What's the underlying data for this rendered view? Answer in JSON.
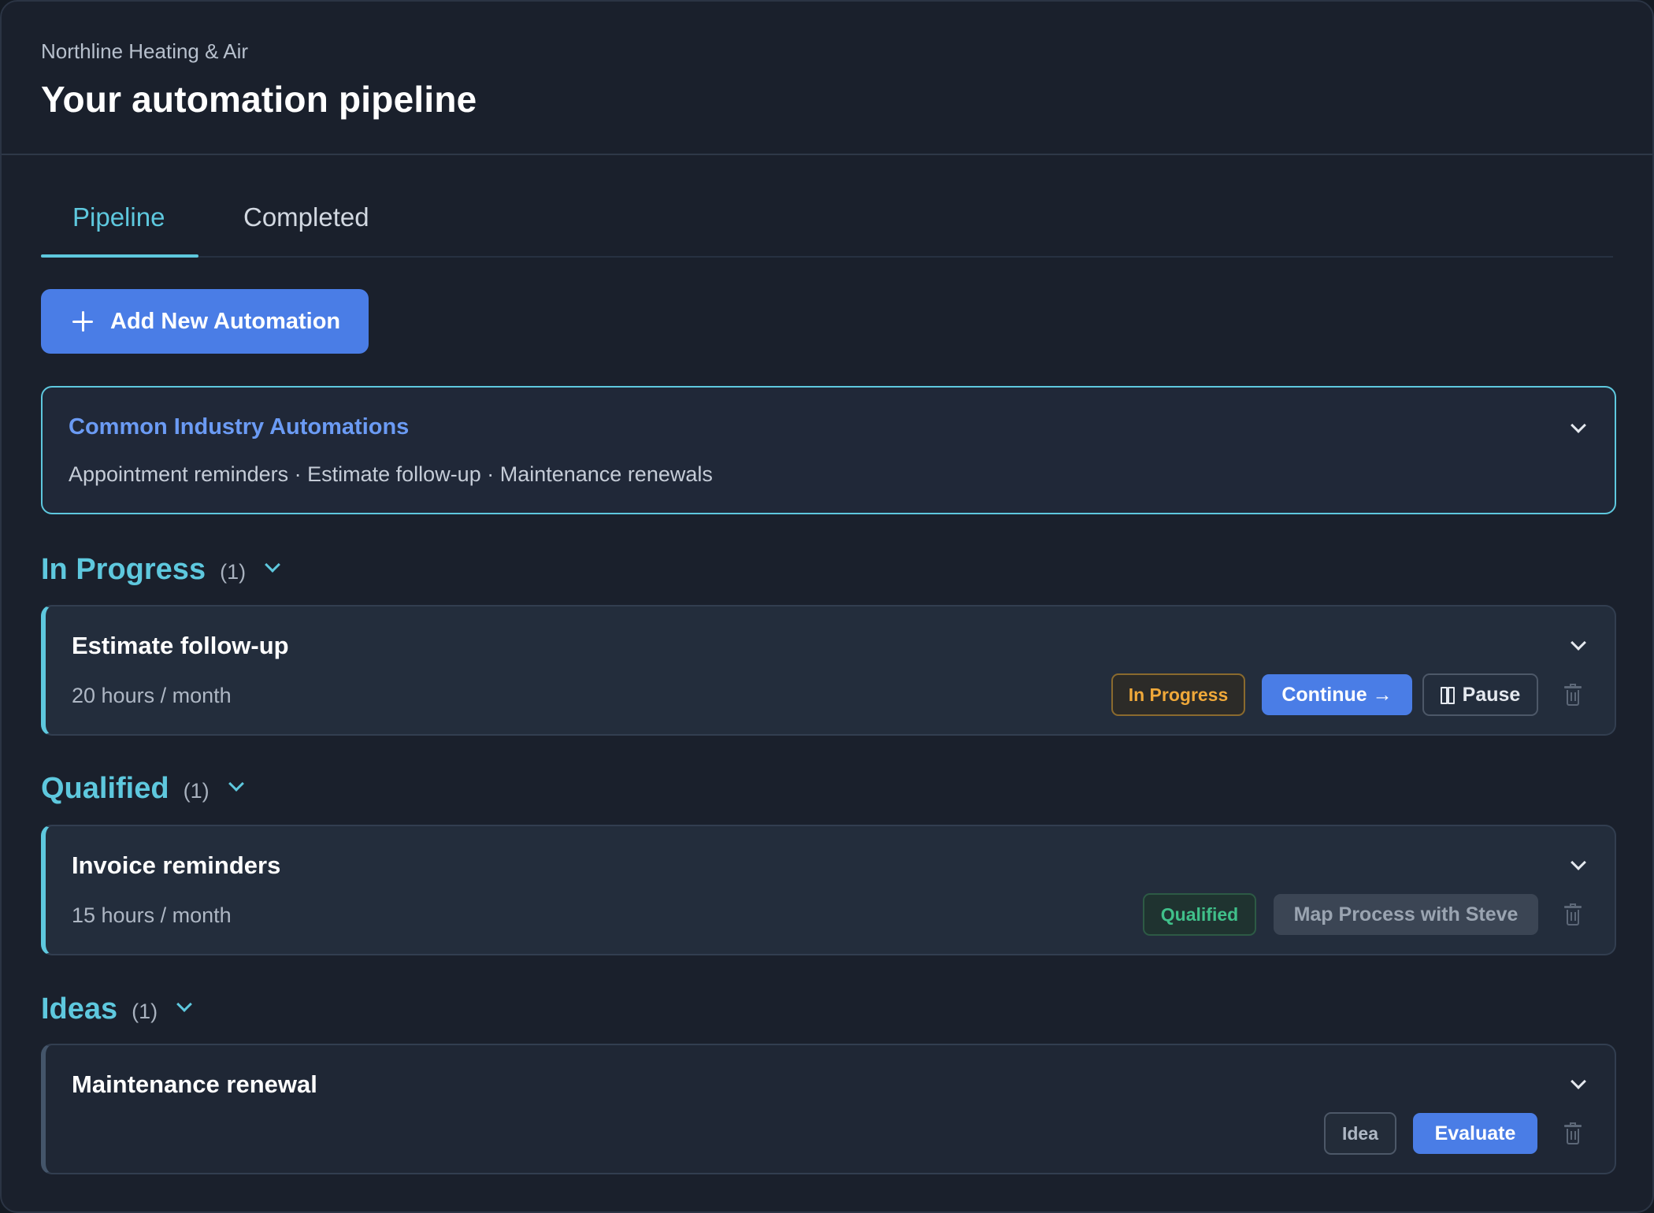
{
  "header": {
    "company": "Northline Heating & Air",
    "title": "Your automation pipeline"
  },
  "tabs": [
    {
      "label": "Pipeline",
      "active": true
    },
    {
      "label": "Completed",
      "active": false
    }
  ],
  "add_button": {
    "label": "Add New Automation",
    "icon": "plus-icon"
  },
  "industry": {
    "title": "Common Industry Automations",
    "items": "Appointment reminders · Estimate follow-up · Maintenance renewals"
  },
  "sections": {
    "in_progress": {
      "title": "In Progress",
      "count": "(1)",
      "card": {
        "title": "Estimate follow-up",
        "meta": "20 hours / month",
        "badge": "In Progress",
        "primary": "Continue →",
        "secondary": "Pause"
      }
    },
    "qualified": {
      "title": "Qualified",
      "count": "(1)",
      "card": {
        "title": "Invoice reminders",
        "meta": "15 hours / month",
        "badge": "Qualified",
        "action": "Map Process with Steve"
      }
    },
    "ideas": {
      "title": "Ideas",
      "count": "(1)",
      "card": {
        "title": "Maintenance renewal",
        "badge": "Idea",
        "action": "Evaluate"
      }
    }
  },
  "colors": {
    "accent": "#5ec8de",
    "primary_button": "#4a7de6",
    "in_progress": "#f0a93a",
    "qualified": "#40c08a",
    "background": "#1a202c"
  }
}
